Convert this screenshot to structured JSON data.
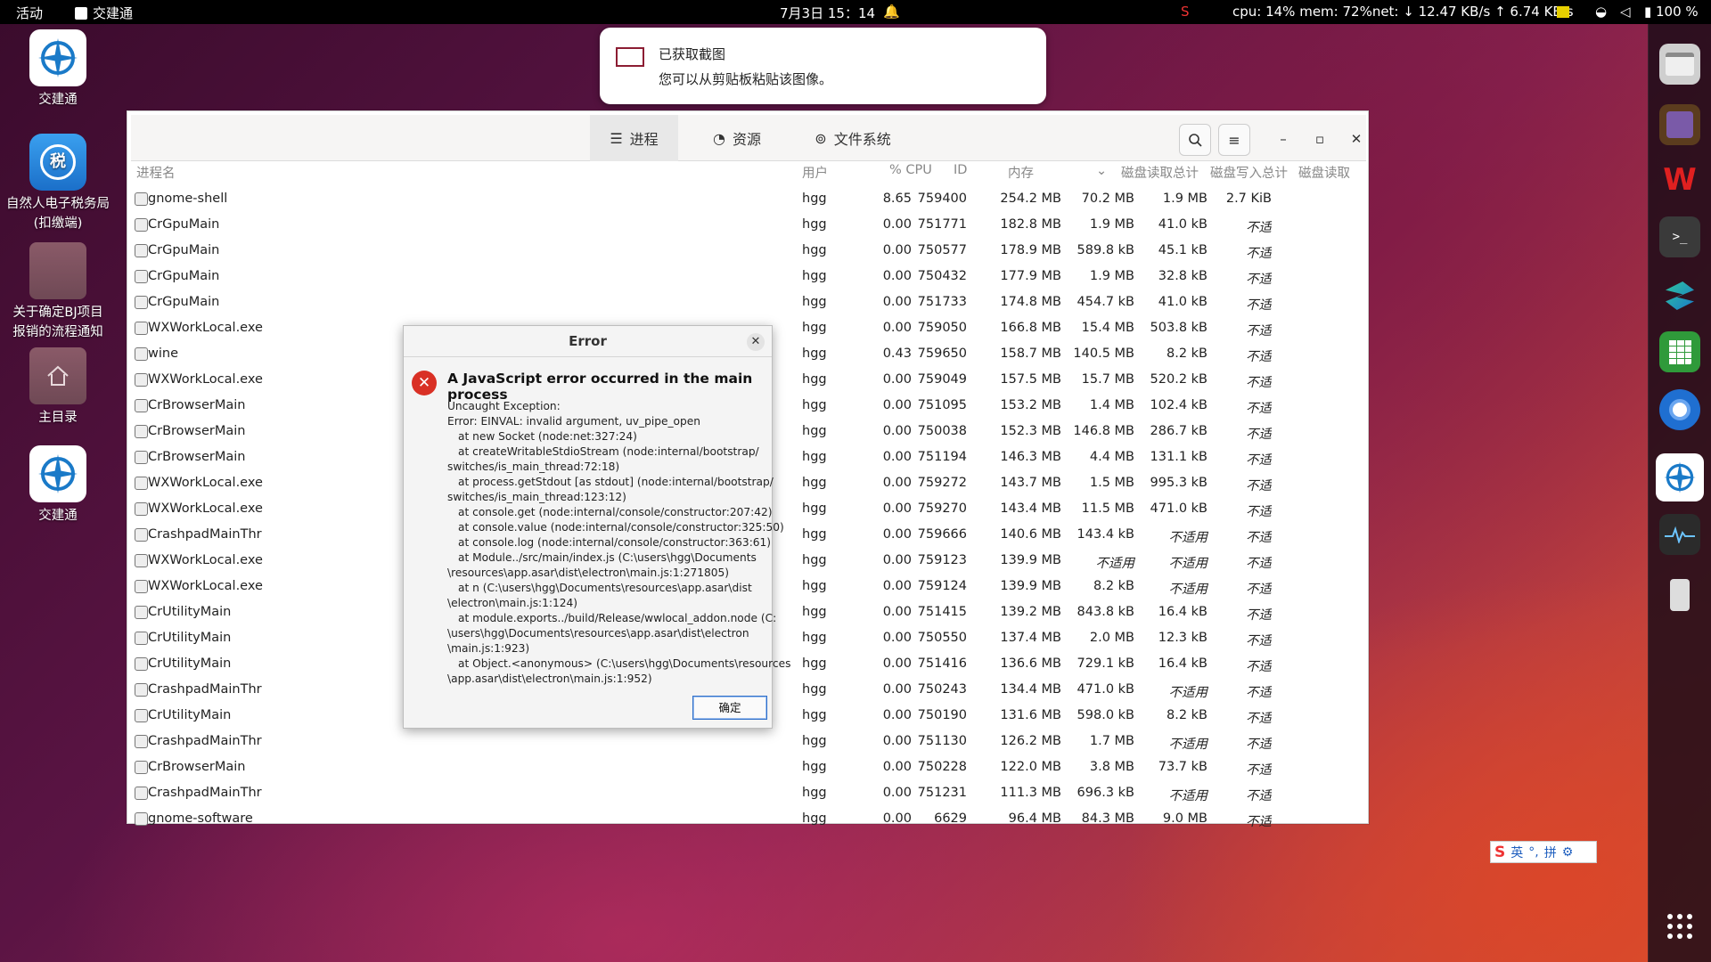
{
  "topbar": {
    "activities": "活动",
    "app": "交建通",
    "datetime": "7月3日  15：14",
    "sysinfo": "cpu: 14% mem: 72%net: ↓  12.47 KB/s ↑  6.74 KB/s",
    "battery": "100 %"
  },
  "notification": {
    "title": "已获取截图",
    "body": "您可以从剪贴板粘贴该图像。"
  },
  "desktop": {
    "icons": [
      {
        "label": "交建通",
        "icon": "jiaojiantong-icon"
      },
      {
        "label": "自然人电子税务局\n(扣缴端)",
        "icon": "tax-bureau-icon"
      },
      {
        "label": "关于确定BJ项目\n报销的流程通知",
        "icon": "folder-icon"
      },
      {
        "label": "主目录",
        "icon": "home-folder-icon"
      },
      {
        "label": "交建通",
        "icon": "jiaojiantong-icon"
      }
    ]
  },
  "dock": {
    "items": [
      "files-icon",
      "calendar-icon",
      "wps-icon",
      "terminal-icon",
      "app-icon",
      "spreadsheet-icon",
      "chromium-icon",
      "jiaojiantong-icon",
      "system-monitor-icon",
      "usb-icon"
    ]
  },
  "sysmon": {
    "tabs": [
      "进程",
      "资源",
      "文件系统"
    ],
    "columns": {
      "name": "进程名",
      "user": "用户",
      "cpu": "% CPU",
      "id": "ID",
      "mem": "内存",
      "read_total": "磁盘读取总计",
      "write_total": "磁盘写入总计",
      "read": "磁盘读取"
    },
    "rows": [
      [
        "gnome-shell",
        "hgg",
        "8.65",
        "759400",
        "254.2 MB",
        "70.2 MB",
        "1.9 MB",
        "2.7 KiB"
      ],
      [
        "CrGpuMain",
        "hgg",
        "0.00",
        "751771",
        "182.8 MB",
        "1.9 MB",
        "41.0 kB",
        "不适"
      ],
      [
        "CrGpuMain",
        "hgg",
        "0.00",
        "750577",
        "178.9 MB",
        "589.8 kB",
        "45.1 kB",
        "不适"
      ],
      [
        "CrGpuMain",
        "hgg",
        "0.00",
        "750432",
        "177.9 MB",
        "1.9 MB",
        "32.8 kB",
        "不适"
      ],
      [
        "CrGpuMain",
        "hgg",
        "0.00",
        "751733",
        "174.8 MB",
        "454.7 kB",
        "41.0 kB",
        "不适"
      ],
      [
        "WXWorkLocal.exe",
        "hgg",
        "0.00",
        "759050",
        "166.8 MB",
        "15.4 MB",
        "503.8 kB",
        "不适"
      ],
      [
        "wine",
        "hgg",
        "0.43",
        "759650",
        "158.7 MB",
        "140.5 MB",
        "8.2 kB",
        "不适"
      ],
      [
        "WXWorkLocal.exe",
        "hgg",
        "0.00",
        "759049",
        "157.5 MB",
        "15.7 MB",
        "520.2 kB",
        "不适"
      ],
      [
        "CrBrowserMain",
        "hgg",
        "0.00",
        "751095",
        "153.2 MB",
        "1.4 MB",
        "102.4 kB",
        "不适"
      ],
      [
        "CrBrowserMain",
        "hgg",
        "0.00",
        "750038",
        "152.3 MB",
        "146.8 MB",
        "286.7 kB",
        "不适"
      ],
      [
        "CrBrowserMain",
        "hgg",
        "0.00",
        "751194",
        "146.3 MB",
        "4.4 MB",
        "131.1 kB",
        "不适"
      ],
      [
        "WXWorkLocal.exe",
        "hgg",
        "0.00",
        "759272",
        "143.7 MB",
        "1.5 MB",
        "995.3 kB",
        "不适"
      ],
      [
        "WXWorkLocal.exe",
        "hgg",
        "0.00",
        "759270",
        "143.4 MB",
        "11.5 MB",
        "471.0 kB",
        "不适"
      ],
      [
        "CrashpadMainThr",
        "hgg",
        "0.00",
        "759666",
        "140.6 MB",
        "143.4 kB",
        "不适用",
        "不适"
      ],
      [
        "WXWorkLocal.exe",
        "hgg",
        "0.00",
        "759123",
        "139.9 MB",
        "不适用",
        "不适用",
        "不适"
      ],
      [
        "WXWorkLocal.exe",
        "hgg",
        "0.00",
        "759124",
        "139.9 MB",
        "8.2 kB",
        "不适用",
        "不适"
      ],
      [
        "CrUtilityMain",
        "hgg",
        "0.00",
        "751415",
        "139.2 MB",
        "843.8 kB",
        "16.4 kB",
        "不适"
      ],
      [
        "CrUtilityMain",
        "hgg",
        "0.00",
        "750550",
        "137.4 MB",
        "2.0 MB",
        "12.3 kB",
        "不适"
      ],
      [
        "CrUtilityMain",
        "hgg",
        "0.00",
        "751416",
        "136.6 MB",
        "729.1 kB",
        "16.4 kB",
        "不适"
      ],
      [
        "CrashpadMainThr",
        "hgg",
        "0.00",
        "750243",
        "134.4 MB",
        "471.0 kB",
        "不适用",
        "不适"
      ],
      [
        "CrUtilityMain",
        "hgg",
        "0.00",
        "750190",
        "131.6 MB",
        "598.0 kB",
        "8.2 kB",
        "不适"
      ],
      [
        "CrashpadMainThr",
        "hgg",
        "0.00",
        "751130",
        "126.2 MB",
        "1.7 MB",
        "不适用",
        "不适"
      ],
      [
        "CrBrowserMain",
        "hgg",
        "0.00",
        "750228",
        "122.0 MB",
        "3.8 MB",
        "73.7 kB",
        "不适"
      ],
      [
        "CrashpadMainThr",
        "hgg",
        "0.00",
        "751231",
        "111.3 MB",
        "696.3 kB",
        "不适用",
        "不适"
      ],
      [
        "gnome-software",
        "hgg",
        "0.00",
        "6629",
        "96.4 MB",
        "84.3 MB",
        "9.0 MB",
        "不适"
      ]
    ]
  },
  "dialog": {
    "title": "Error",
    "heading": "A JavaScript error occurred in the main process",
    "lines": [
      {
        "t": "Uncaught Exception:",
        "i": 0
      },
      {
        "t": "Error: EINVAL: invalid argument, uv_pipe_open",
        "i": 0
      },
      {
        "t": "at new Socket (node:net:327:24)",
        "i": 1
      },
      {
        "t": "at createWritableStdioStream (node:internal/bootstrap/",
        "i": 1
      },
      {
        "t": "switches/is_main_thread:72:18)",
        "i": 0
      },
      {
        "t": "at process.getStdout [as stdout] (node:internal/bootstrap/",
        "i": 1
      },
      {
        "t": "switches/is_main_thread:123:12)",
        "i": 0
      },
      {
        "t": "at console.get (node:internal/console/constructor:207:42)",
        "i": 1
      },
      {
        "t": "at console.value (node:internal/console/constructor:325:50)",
        "i": 1
      },
      {
        "t": "at console.log (node:internal/console/constructor:363:61)",
        "i": 1
      },
      {
        "t": "at Module../src/main/index.js (C:\\users\\hgg\\Documents",
        "i": 1
      },
      {
        "t": "\\resources\\app.asar\\dist\\electron\\main.js:1:271805)",
        "i": 0
      },
      {
        "t": "at n (C:\\users\\hgg\\Documents\\resources\\app.asar\\dist",
        "i": 1
      },
      {
        "t": "\\electron\\main.js:1:124)",
        "i": 0
      },
      {
        "t": "at module.exports../build/Release/wwlocal_addon.node (C:",
        "i": 1
      },
      {
        "t": "\\users\\hgg\\Documents\\resources\\app.asar\\dist\\electron",
        "i": 0
      },
      {
        "t": "\\main.js:1:923)",
        "i": 0
      },
      {
        "t": "at Object.<anonymous> (C:\\users\\hgg\\Documents\\resources",
        "i": 1
      },
      {
        "t": "\\app.asar\\dist\\electron\\main.js:1:952)",
        "i": 0
      }
    ],
    "ok": "确定"
  },
  "ime": {
    "lang": "英",
    "mode": "拼"
  },
  "colors": {
    "accent": "#2f6fc9",
    "error": "#d93025"
  }
}
